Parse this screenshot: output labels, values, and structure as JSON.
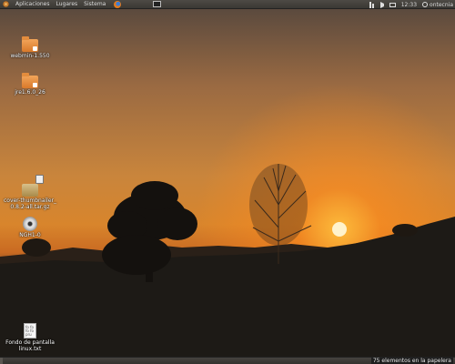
{
  "top_panel": {
    "menus": [
      "Aplicaciones",
      "Lugares",
      "Sistema"
    ],
    "clock": "12:33",
    "user": "ontecnia"
  },
  "icons": {
    "ubuntu_logo": "ubuntu-logo-icon",
    "browser": "firefox-icon",
    "show_desktop": "show-desktop-icon",
    "network": "network-icon",
    "volume": "volume-icon",
    "mail": "mail-icon",
    "user": "user-icon"
  },
  "desktop_icons": [
    {
      "label": "webmin-1.550",
      "type": "folder"
    },
    {
      "label": "jre1.6.0_26",
      "type": "folder"
    },
    {
      "label": "cover-thumbnailer_0.8.2-all.tar.gz",
      "label_line1": "cover-thumbnailer_",
      "label_line2": "0.8.2-all.tar.gz",
      "type": "archive"
    },
    {
      "label": "NGH1-0",
      "type": "cd"
    },
    {
      "label": "Fondo de pantalla linux.txt",
      "label_line1": "Fondo de pantalla",
      "label_line2": "linux.txt",
      "type": "text-file"
    }
  ],
  "text_file_preview": [
    "fo fo",
    "fo fo",
    "pru"
  ],
  "bottom_panel": {
    "trash_status": "75 elementos en la papelera"
  },
  "colors": {
    "panel": "#3a3834",
    "folder": "#e38c3d",
    "sun": "#ffe9b0"
  }
}
